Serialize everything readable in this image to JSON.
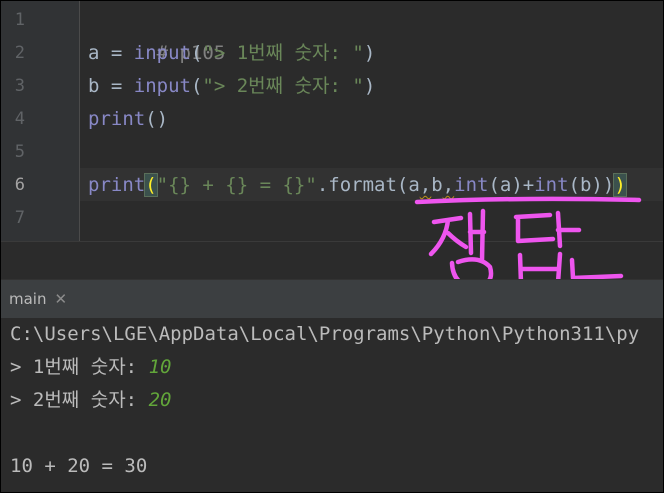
{
  "editor": {
    "line_numbers": [
      "1",
      "2",
      "3",
      "4",
      "5",
      "6",
      "7"
    ],
    "active_line": "6",
    "lines": {
      "l1": {
        "comment": "# p105"
      },
      "l2": {
        "lhs": "a = ",
        "fn": "input",
        "open": "(",
        "arg": "\"> 1번째 숫자: \"",
        "close": ")"
      },
      "l3": {
        "lhs": "b = ",
        "fn": "input",
        "open": "(",
        "arg": "\"> 2번째 숫자: \"",
        "close": ")"
      },
      "l4": {
        "fn": "print",
        "rest": "()"
      },
      "l6": {
        "fn": "print",
        "open": "(",
        "str": "\"{} + {} = {}\"",
        "mid1": ".format(a",
        "comma1": ",",
        "b": "b",
        "comma2": ",",
        "int1": "int",
        "mid2": "(a)+",
        "int2": "int",
        "mid3": "(b))",
        "close": ")"
      }
    }
  },
  "annotation": {
    "text": "정답",
    "color": "#ee55ee"
  },
  "run_panel": {
    "tab_label": "main",
    "close_glyph": "✕",
    "console": {
      "path": "C:\\Users\\LGE\\AppData\\Local\\Programs\\Python\\Python311\\py",
      "prompt1": "> 1번째 숫자: ",
      "input1": "10",
      "prompt2": "> 2번째 숫자: ",
      "input2": "20",
      "result": "10 + 20 = 30"
    }
  }
}
